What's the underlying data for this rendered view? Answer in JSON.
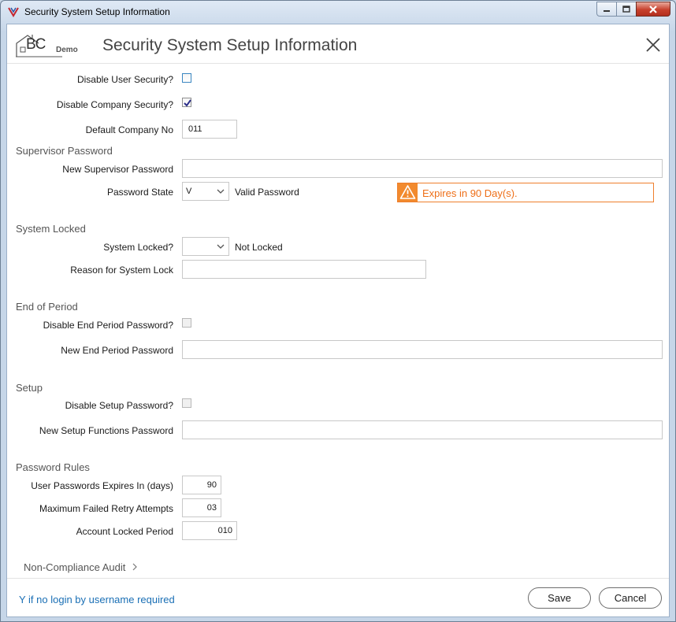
{
  "window": {
    "title": "Security System Setup Information",
    "controls": [
      "minimize-icon",
      "maximize-icon",
      "close-icon"
    ]
  },
  "header": {
    "logo_text": "BC",
    "logo_sub": "Demo",
    "title": "Security System Setup Information"
  },
  "general": {
    "disable_user_security": {
      "label": "Disable User Security?",
      "checked": false
    },
    "disable_company_security": {
      "label": "Disable Company Security?",
      "checked": true
    },
    "default_company": {
      "label": "Default Company No",
      "value": "011"
    }
  },
  "supervisor": {
    "section": "Supervisor Password",
    "new_password": {
      "label": "New Supervisor Password",
      "value": ""
    },
    "state": {
      "label": "Password State",
      "value": "V",
      "status": "Valid Password"
    },
    "alert": {
      "text": "Expires in 90 Day(s).",
      "icon": "warning-icon",
      "color": "#ee7f2d"
    }
  },
  "locked": {
    "section": "System Locked",
    "system_locked": {
      "label": "System Locked?",
      "value": "",
      "status": "Not Locked"
    },
    "reason": {
      "label": "Reason for System Lock",
      "value": ""
    }
  },
  "end_period": {
    "section": "End of Period",
    "disable": {
      "label": "Disable End Period Password?",
      "checked": false
    },
    "new_password": {
      "label": "New End Period Password",
      "value": ""
    }
  },
  "setup": {
    "section": "Setup",
    "disable": {
      "label": "Disable Setup Password?",
      "checked": false
    },
    "new_password": {
      "label": "New Setup Functions Password",
      "value": ""
    }
  },
  "rules": {
    "section": "Password Rules",
    "expires": {
      "label": "User Passwords Expires In (days)",
      "value": "90"
    },
    "retries": {
      "label": "Maximum Failed Retry Attempts",
      "value": "03"
    },
    "lock_period": {
      "label": "Account Locked Period",
      "value": "010"
    }
  },
  "audit": {
    "label": "Non-Compliance Audit"
  },
  "footer": {
    "hint": "Y if no login by username required",
    "save": "Save",
    "cancel": "Cancel"
  },
  "colors": {
    "accent_blue": "#1a6fb5",
    "warning_orange": "#ee7f2d",
    "title_bar": "#c6d6e8"
  }
}
